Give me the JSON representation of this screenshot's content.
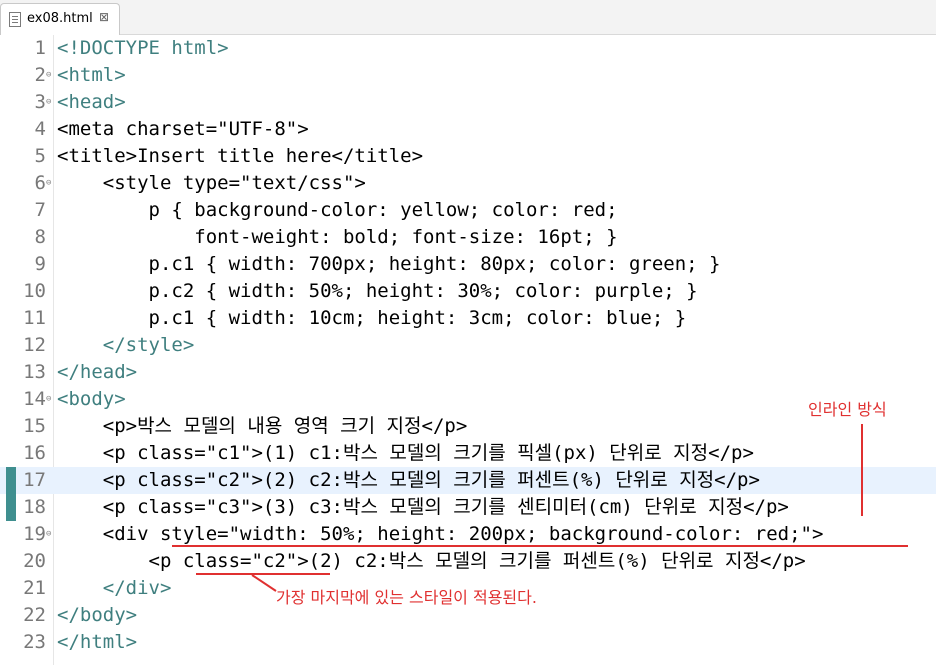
{
  "tab": {
    "filename": "ex08.html",
    "close_symbol": "⊠"
  },
  "lines": [
    {
      "n": "1",
      "plain": "<!DOCTYPE html>"
    },
    {
      "n": "2",
      "plain": "<html>"
    },
    {
      "n": "3",
      "plain": "<head>"
    },
    {
      "n": "4",
      "plain": "<meta charset=\"UTF-8\">"
    },
    {
      "n": "5",
      "plain": "<title>Insert title here</title>"
    },
    {
      "n": "6",
      "plain": "    <style type=\"text/css\">"
    },
    {
      "n": "7",
      "plain": "        p { background-color: yellow; color: red;"
    },
    {
      "n": "8",
      "plain": "            font-weight: bold; font-size: 16pt; }"
    },
    {
      "n": "9",
      "plain": "        p.c1 { width: 700px; height: 80px; color: green; }"
    },
    {
      "n": "10",
      "plain": "        p.c2 { width: 50%; height: 30%; color: purple; }"
    },
    {
      "n": "11",
      "plain": "        p.c1 { width: 10cm; height: 3cm; color: blue; }"
    },
    {
      "n": "12",
      "plain": "    </style>"
    },
    {
      "n": "13",
      "plain": "</head>"
    },
    {
      "n": "14",
      "plain": "<body>"
    },
    {
      "n": "15",
      "plain": "    <p>박스 모델의 내용 영역 크기 지정</p>"
    },
    {
      "n": "16",
      "plain": "    <p class=\"c1\">(1) c1:박스 모델의 크기를 픽셀(px) 단위로 지정</p>"
    },
    {
      "n": "17",
      "plain": "    <p class=\"c2\">(2) c2:박스 모델의 크기를 퍼센트(%) 단위로 지정</p>"
    },
    {
      "n": "18",
      "plain": "    <p class=\"c3\">(3) c3:박스 모델의 크기를 센티미터(cm) 단위로 지정</p>"
    },
    {
      "n": "19",
      "plain": "    <div style=\"width: 50%; height: 200px; background-color: red;\">"
    },
    {
      "n": "20",
      "plain": "        <p class=\"c2\">(2) c2:박스 모델의 크기를 퍼센트(%) 단위로 지정</p>"
    },
    {
      "n": "21",
      "plain": "    </div>"
    },
    {
      "n": "22",
      "plain": "</body>"
    },
    {
      "n": "23",
      "plain": "</html>"
    }
  ],
  "annotations": {
    "inline_style": "인라인 방식",
    "last_style": "가장 마지막에 있는 스타일이 적용된다."
  },
  "colors": {
    "annotation": "#e03030",
    "tag": "#3f7f7f",
    "attribute": "#7f007f",
    "string": "#2a00ff"
  }
}
